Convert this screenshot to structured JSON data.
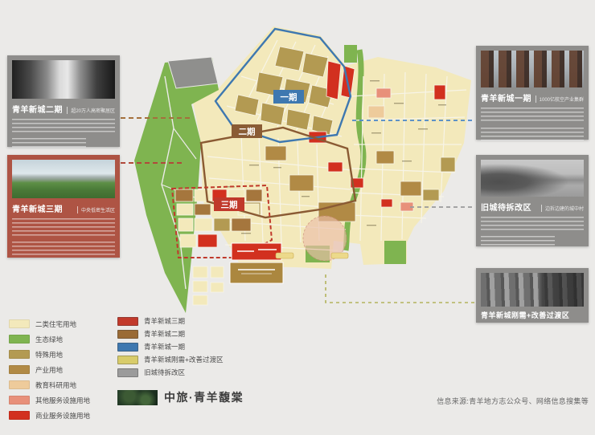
{
  "page": {
    "background": "#ebeae8"
  },
  "cards": {
    "left": [
      {
        "title": "青羊新城二期",
        "badge": "超20万人高密聚居区"
      },
      {
        "title": "青羊新城三期",
        "badge": "中央低密生活区"
      }
    ],
    "right": [
      {
        "title": "青羊新城一期",
        "badge": "1000亿航空产业集群"
      },
      {
        "title": "旧城待拆改区",
        "badge": "边拆边建的城中村"
      },
      {
        "title": "青羊新城刚需+改善过渡区",
        "badge": ""
      }
    ]
  },
  "map": {
    "labels": {
      "phase1": "一期",
      "phase2": "二期",
      "phase3": "三期"
    }
  },
  "legend": {
    "land_use": [
      {
        "label": "二类住宅用地",
        "color": "#f3e9bb"
      },
      {
        "label": "生态绿地",
        "color": "#7fb450"
      },
      {
        "label": "特殊用地",
        "color": "#b39a52"
      },
      {
        "label": "产业用地",
        "color": "#b18a45"
      },
      {
        "label": "教育科研用地",
        "color": "#eecb9b"
      },
      {
        "label": "其他服务设施用地",
        "color": "#e8907a"
      },
      {
        "label": "商业服务设施用地",
        "color": "#d2301f"
      }
    ],
    "zones": [
      {
        "label": "青羊新城三期",
        "color": "#c23a2b"
      },
      {
        "label": "青羊新城二期",
        "color": "#9a6b35"
      },
      {
        "label": "青羊新城一期",
        "color": "#3e78b0"
      },
      {
        "label": "青羊新城刚需+改善过渡区",
        "color": "#d8cc6a"
      },
      {
        "label": "旧城待拆改区",
        "color": "#9b9b9b"
      }
    ]
  },
  "footer": {
    "logo_text": "中旅·青羊馥棠",
    "source": "信息来源:青羊地方志公众号、网络信息搜集等"
  }
}
